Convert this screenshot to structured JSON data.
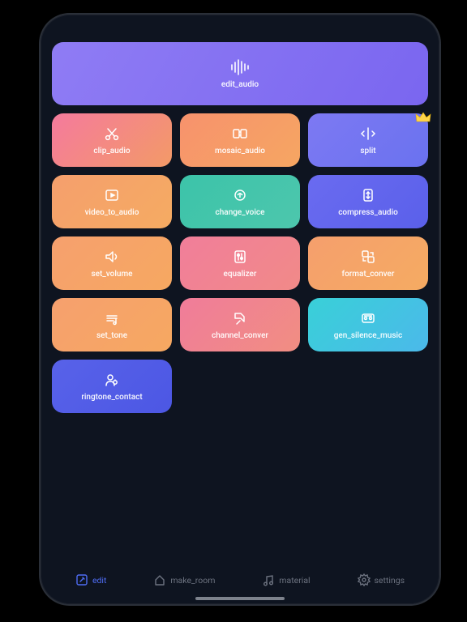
{
  "hero": {
    "label": "edit_audio"
  },
  "tiles": [
    {
      "label": "clip_audio",
      "icon": "scissors",
      "cls": "g-pink-or",
      "premium": false
    },
    {
      "label": "mosaic_audio",
      "icon": "mosaic",
      "cls": "g-orange",
      "premium": false
    },
    {
      "label": "split",
      "icon": "split",
      "cls": "g-blurple",
      "premium": true
    },
    {
      "label": "video_to_audio",
      "icon": "video",
      "cls": "g-or",
      "premium": false
    },
    {
      "label": "change_voice",
      "icon": "voice",
      "cls": "g-teal",
      "premium": false
    },
    {
      "label": "compress_audio",
      "icon": "compress",
      "cls": "g-blurple2",
      "premium": false
    },
    {
      "label": "set_volume",
      "icon": "volume",
      "cls": "g-or2",
      "premium": false
    },
    {
      "label": "equalizer",
      "icon": "equalizer",
      "cls": "g-pink2",
      "premium": false
    },
    {
      "label": "format_conver",
      "icon": "convert",
      "cls": "g-or",
      "premium": false
    },
    {
      "label": "set_tone",
      "icon": "tone",
      "cls": "g-or2",
      "premium": false
    },
    {
      "label": "channel_conver",
      "icon": "channel",
      "cls": "g-pink3",
      "premium": false
    },
    {
      "label": "gen_silence_music",
      "icon": "gensilence",
      "cls": "g-cyan",
      "premium": false
    },
    {
      "label": "ringtone_contact",
      "icon": "ringtone",
      "cls": "g-indigo",
      "premium": false
    }
  ],
  "nav": [
    {
      "label": "edit",
      "icon": "edit",
      "active": true
    },
    {
      "label": "make_room",
      "icon": "home",
      "active": false
    },
    {
      "label": "material",
      "icon": "music",
      "active": false
    },
    {
      "label": "settings",
      "icon": "settings",
      "active": false
    }
  ]
}
